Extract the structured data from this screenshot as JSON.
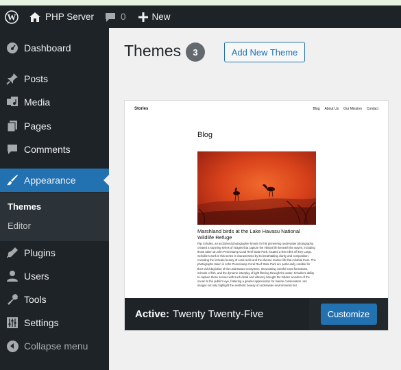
{
  "admin_bar": {
    "site_name": "PHP Server",
    "comments_count": "0",
    "new_label": "New"
  },
  "sidebar": {
    "items": [
      {
        "label": "Dashboard",
        "icon": "dashboard-icon"
      },
      {
        "label": "Posts",
        "icon": "pin-icon"
      },
      {
        "label": "Media",
        "icon": "media-icon"
      },
      {
        "label": "Pages",
        "icon": "pages-icon"
      },
      {
        "label": "Comments",
        "icon": "comment-icon"
      },
      {
        "label": "Appearance",
        "icon": "brush-icon",
        "active": true
      },
      {
        "label": "Plugins",
        "icon": "plugin-icon"
      },
      {
        "label": "Users",
        "icon": "user-icon"
      },
      {
        "label": "Tools",
        "icon": "wrench-icon"
      },
      {
        "label": "Settings",
        "icon": "settings-icon"
      }
    ],
    "submenu": [
      "Themes",
      "Editor"
    ],
    "collapse_label": "Collapse menu"
  },
  "main": {
    "title": "Themes",
    "count": "3",
    "add_new_label": "Add New Theme"
  },
  "theme": {
    "active_label": "Active:",
    "name": "Twenty Twenty-Five",
    "customize_label": "Customize",
    "preview": {
      "site_title": "Stories",
      "nav": [
        "Blog",
        "About Us",
        "Our Mission",
        "Contact"
      ],
      "heading": "Blog",
      "post_title": "Marshland birds at the Lake Havasu National Wildlife Refuge",
      "excerpt": "Flip Schulke, an acclaimed photographer known for his pioneering underwater photography, created a stunning series of images that capture the vibrant life beneath the waves, including those taken at John Pennekamp Coral Reef State Park, located a few miles off Key Largo. Schulke's work in this series is characterized by its breathtaking clarity and composition, revealing the intricate beauty of coral reefs and the diverse marine life that inhabits them. The photographs taken in John Pennekamp Coral Reef State Park are particularly notable for their vivid depiction of the underwater ecosystem, showcasing colorful coral formations, schools of fish, and the dynamic interplay of light filtering through the water. Schulke's ability to capture these scenes with such detail and vibrancy brought the hidden wonders of the ocean to the public's eye, fostering a greater appreciation for marine conservation. His images not only highlight the aesthetic beauty of underwater environments but"
    }
  },
  "colors": {
    "admin_dark": "#1d2327",
    "accent": "#2271b1",
    "background": "#f0f0f1"
  }
}
